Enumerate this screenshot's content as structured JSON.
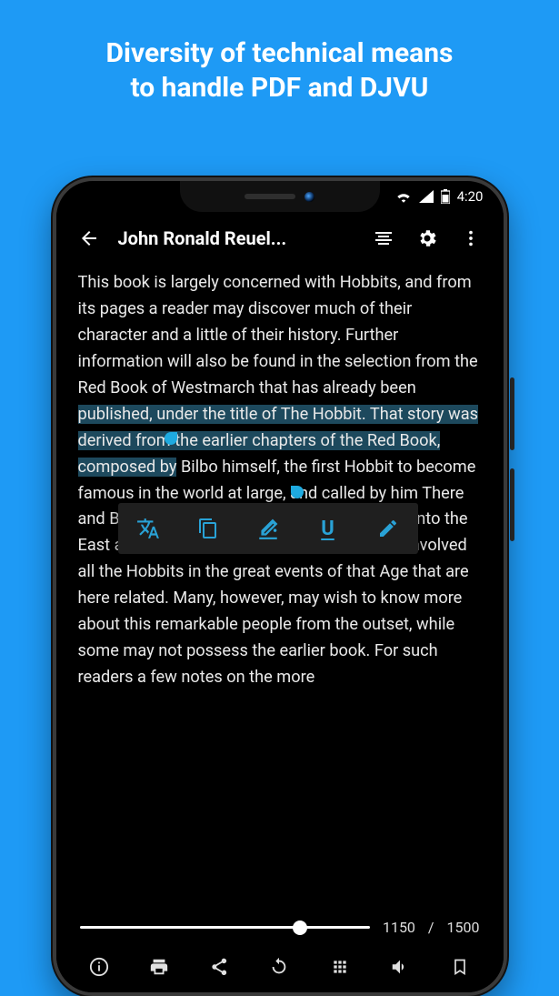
{
  "promo": {
    "line1": "Diversity of technical means",
    "line2": "to handle PDF and DJVU"
  },
  "status": {
    "time": "4:20"
  },
  "appbar": {
    "title": "John Ronald Reuel..."
  },
  "reader": {
    "pre": "This book is largely concerned with Hobbits, and from its pages a reader may discover much of their character and a little of their history. Further information will also be found in the selection from the Red Book of Westmarch that has already been ",
    "highlighted": "published, under the title of The Hobbit. That story was derived from the earlier chapters of the Red Book, composed by",
    "post": " Bilbo himself, the first Hobbit to become famous in the world at large, and called by him There and Back Again, since they told of his journey into the East and his return: an adventure which later involved all the Hobbits in the great events of that Age that are here related. Many, however, may wish to know more about this remarkable people from the outset, while some may not possess the earlier book. For such readers a few notes on the more"
  },
  "popup": {
    "translate": "translate",
    "copy": "copy",
    "highlight": "highlight",
    "underline": "underline",
    "draw": "draw"
  },
  "pager": {
    "current": "1150",
    "sep": "/",
    "total": "1500",
    "progress_pct": 76
  },
  "bottombar": {
    "info": "info",
    "print": "print",
    "share": "share",
    "update": "update",
    "grid": "grid",
    "audio": "audio",
    "bookmark": "bookmark"
  }
}
